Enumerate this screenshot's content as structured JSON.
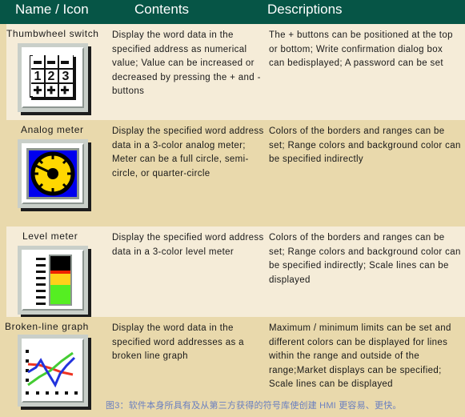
{
  "header": {
    "col_name": "Name / Icon",
    "col_contents": "Contents",
    "col_descriptions": "Descriptions"
  },
  "colors": {
    "header_bg": "#065546",
    "header_text": "#ffffff",
    "row_light": "#f5ecd8",
    "row_dark": "#e9d9ac",
    "body_text": "#191919",
    "caption_text": "#6a7fc0",
    "meter_blue": "#0000ee",
    "meter_yellow": "#ffd700",
    "level_green": "#55ee22",
    "level_yellow": "#ffd11a",
    "level_red": "#ee2200",
    "level_black": "#000000",
    "graph_red": "#ee3322",
    "graph_green": "#44cc33",
    "graph_blue": "#2233dd"
  },
  "rows": [
    {
      "name": "Thumbwheel switch",
      "icon": "thumbwheel-switch-icon",
      "contents": "Display the word data in the specified address as numerical value; Value can be increased or decreased by pressing the + and - buttons",
      "descriptions": "The + buttons can be positioned at the top or bottom; Write confirmation dialog box can bedisplayed; A password can be set"
    },
    {
      "name": "Analog meter",
      "icon": "analog-meter-icon",
      "contents": "Display the specified word address data in a 3-color analog meter; Meter can be a full circle, semi-circle, or quarter-circle",
      "descriptions": "Colors of the borders and ranges can be set; Range colors and background color can be specified indirectly"
    },
    {
      "name": "Level meter",
      "icon": "level-meter-icon",
      "contents": "Display the specified word address data in a 3-color level meter",
      "descriptions": "Colors of the borders and ranges can be set; Range colors and background color can be specified indirectly; Scale lines can be displayed"
    },
    {
      "name": "Broken-line graph",
      "icon": "broken-line-graph-icon",
      "contents": "Display the word data in the specified word addresses as a broken line graph",
      "descriptions": "Maximum / minimum limits can be set and different colors can be displayed for lines within the range and outside of the range;Market displays can be specified; Scale lines can be displayed"
    }
  ],
  "thumbwheel_icon": {
    "digits": [
      "1",
      "2",
      "3"
    ],
    "top_symbols": [
      "–",
      "–",
      "–"
    ],
    "bottom_symbols": [
      "+",
      "+",
      "+"
    ]
  },
  "caption": "图3：软件本身所具有及从第三方获得的符号库使创建 HMI 更容易、更快。"
}
